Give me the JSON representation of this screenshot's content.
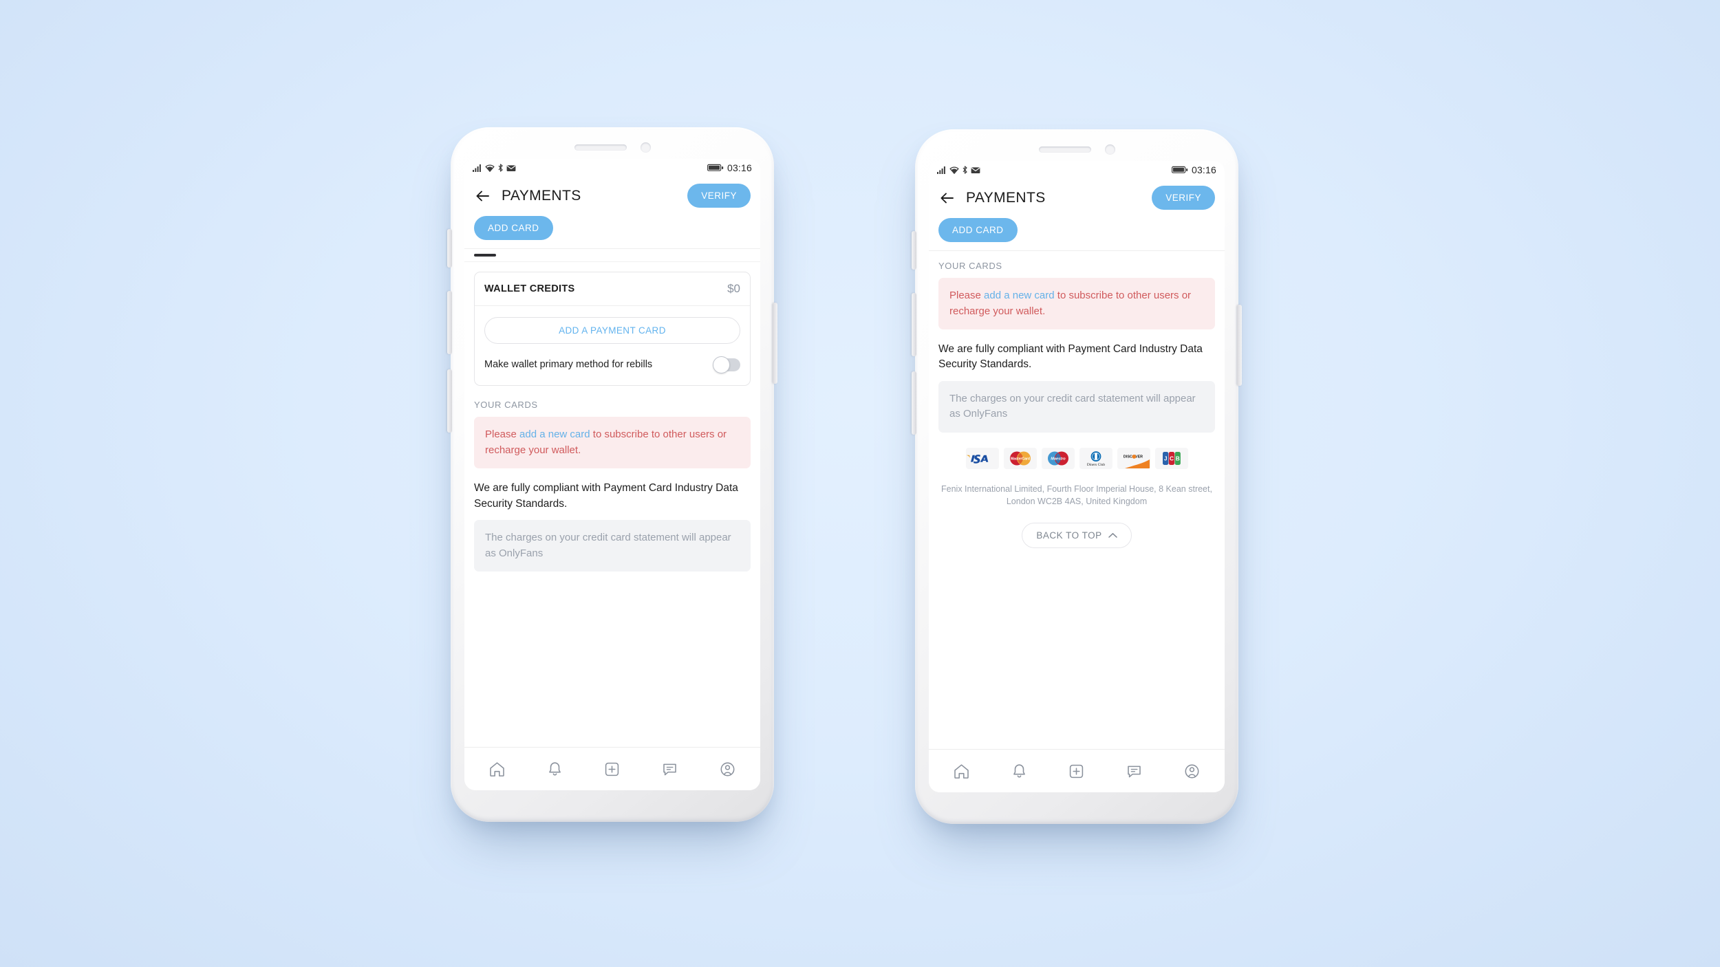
{
  "background_color": "#ddecfd",
  "accent_color": "#6cb7ec",
  "alert_bg_color": "#fbeced",
  "alert_text_color": "#d05a5c",
  "status_bar": {
    "time": "03:16",
    "icons": [
      "signal-icon",
      "wifi-icon",
      "bluetooth-icon",
      "mail-icon",
      "battery-icon"
    ]
  },
  "header": {
    "back_label": "back-arrow",
    "title": "PAYMENTS",
    "verify_label": "VERIFY",
    "add_card_label": "ADD CARD"
  },
  "wallet": {
    "title": "WALLET CREDITS",
    "amount": "$0",
    "add_payment_card_label": "ADD A PAYMENT CARD",
    "toggle_label": "Make wallet primary method for rebills",
    "toggle_on": false
  },
  "your_cards": {
    "section_label": "YOUR CARDS",
    "alert_prefix": "Please ",
    "alert_link": "add a new card",
    "alert_suffix": " to subscribe to other users or recharge your wallet."
  },
  "compliance": {
    "text": "We are fully compliant with Payment Card Industry Data Security Standards.",
    "statement_note": "The charges on your credit card statement will appear as OnlyFans"
  },
  "brands": [
    {
      "name": "visa",
      "label": "VISA"
    },
    {
      "name": "mastercard",
      "label": "MasterCard"
    },
    {
      "name": "maestro",
      "label": "Maestro"
    },
    {
      "name": "diners-club",
      "label": "Diners Club"
    },
    {
      "name": "discover",
      "label": "DISCOVER"
    },
    {
      "name": "jcb",
      "label": "JCB"
    }
  ],
  "legal": "Fenix International Limited, Fourth Floor Imperial House, 8 Kean street, London WC2B 4AS, United Kingdom",
  "back_to_top": {
    "label": "BACK TO TOP",
    "icon": "chevron-up-icon"
  },
  "bottom_nav": [
    {
      "name": "home-icon"
    },
    {
      "name": "notifications-bell-icon"
    },
    {
      "name": "add-post-icon"
    },
    {
      "name": "messages-icon"
    },
    {
      "name": "profile-icon"
    }
  ]
}
